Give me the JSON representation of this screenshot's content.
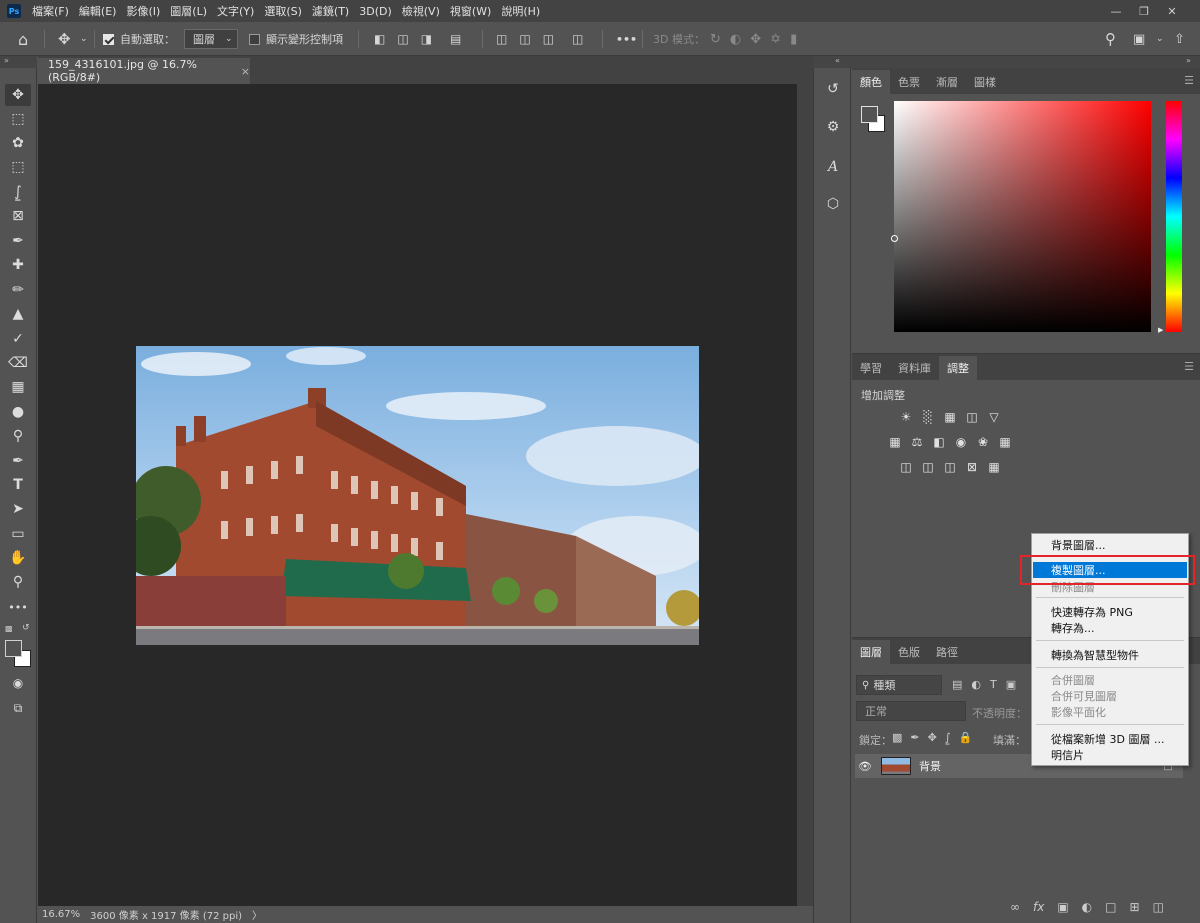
{
  "menubar": {
    "logo": "Ps",
    "items": [
      "檔案(F)",
      "編輯(E)",
      "影像(I)",
      "圖層(L)",
      "文字(Y)",
      "選取(S)",
      "濾鏡(T)",
      "3D(D)",
      "檢視(V)",
      "視窗(W)",
      "說明(H)"
    ]
  },
  "optionsbar": {
    "auto_select_label": "自動選取：",
    "auto_select_value": "圖層",
    "show_transform_label": "顯示變形控制項",
    "more": "•••",
    "mode_3d_label": "3D 模式："
  },
  "document": {
    "tab_title": "159_4316101.jpg @ 16.7% (RGB/8#)",
    "tab_close": "×"
  },
  "statusbar": {
    "zoom": "16.67%",
    "info": "3600 像素 x 1917 像素 (72 ppi)",
    "arrow": "〉"
  },
  "color_panel": {
    "tabs": [
      "顏色",
      "色票",
      "漸層",
      "圖樣"
    ],
    "active_tab": 0,
    "hue_color": "#ff0000"
  },
  "adjustments_panel": {
    "tabs": [
      "學習",
      "資料庫",
      "調整"
    ],
    "active_tab": 2,
    "title": "增加調整"
  },
  "layers_panel": {
    "tabs": [
      "圖層",
      "色版",
      "路徑"
    ],
    "active_tab": 0,
    "filter_label": "種類",
    "blend_mode": "正常",
    "opacity_label": "不透明度：",
    "lock_label": "鎖定：",
    "fill_label": "填滿：",
    "layers": [
      {
        "name": "背景",
        "visible": true,
        "locked": true
      }
    ]
  },
  "context_menu": {
    "items": [
      {
        "label": "背景圖層...",
        "enabled": true
      },
      {
        "label": "複製圖層...",
        "enabled": true,
        "selected": true
      },
      {
        "label": "刪除圖層",
        "enabled": false
      },
      {
        "label": "快速轉存為 PNG",
        "enabled": true
      },
      {
        "label": "轉存為...",
        "enabled": true
      },
      {
        "label": "轉換為智慧型物件",
        "enabled": true
      },
      {
        "label": "合併圖層",
        "enabled": false
      },
      {
        "label": "合併可見圖層",
        "enabled": false
      },
      {
        "label": "影像平面化",
        "enabled": false
      },
      {
        "label": "從檔案新增 3D 圖層 ...",
        "enabled": true
      },
      {
        "label": "明信片",
        "enabled": true
      }
    ]
  }
}
